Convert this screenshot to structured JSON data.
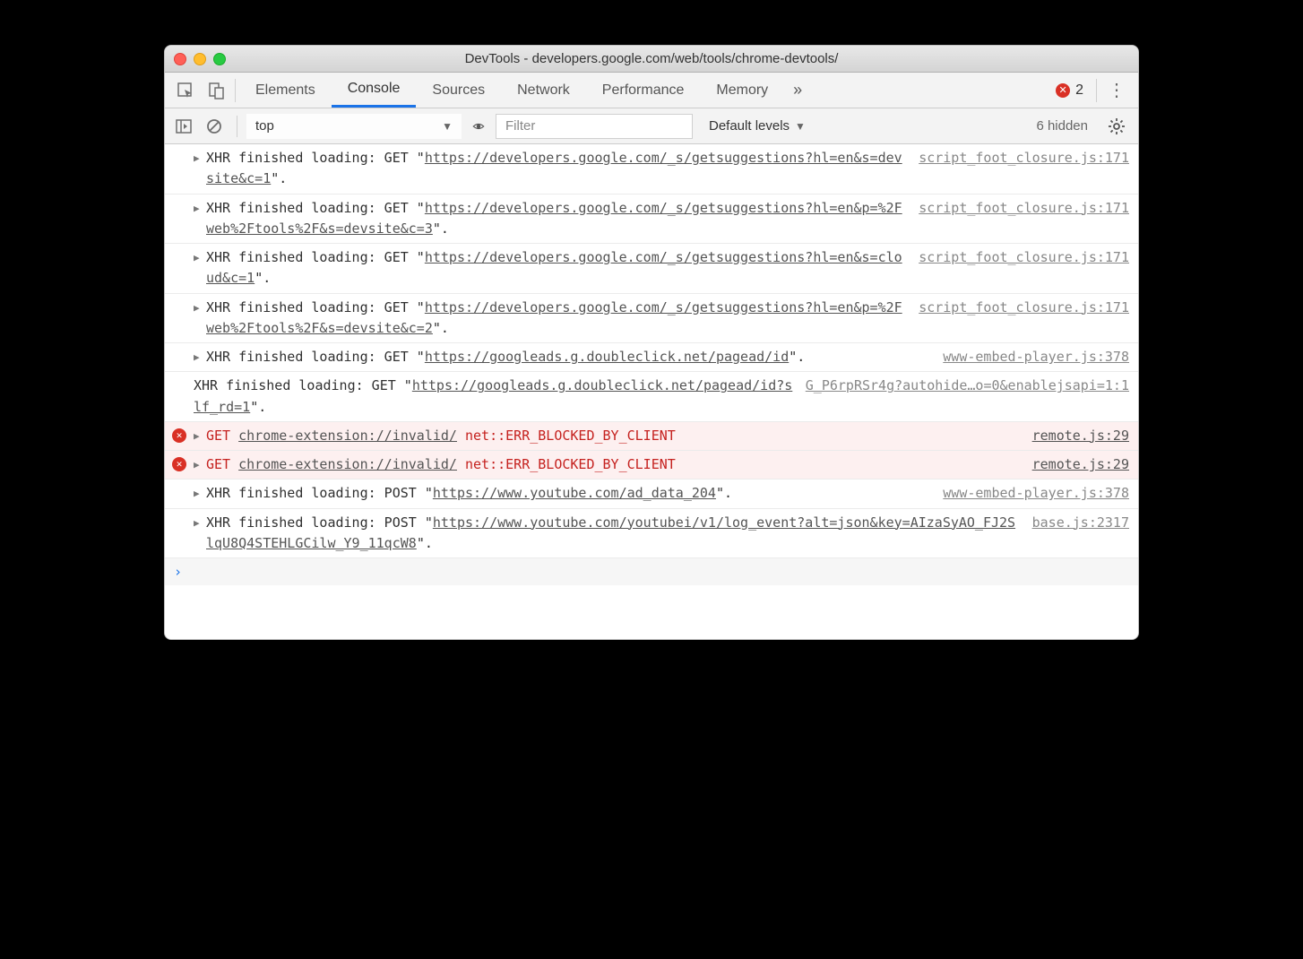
{
  "window": {
    "title": "DevTools - developers.google.com/web/tools/chrome-devtools/"
  },
  "tabs": {
    "items": [
      "Elements",
      "Console",
      "Sources",
      "Network",
      "Performance",
      "Memory"
    ],
    "active": "Console",
    "overflow": "»",
    "error_count": "2"
  },
  "toolbar": {
    "context": "top",
    "filter_placeholder": "Filter",
    "levels": "Default levels",
    "hidden": "6 hidden"
  },
  "log": [
    {
      "type": "xhr",
      "disc": true,
      "prefix": "XHR finished loading: GET \"",
      "url": "https://developers.google.com/_s/getsuggestions?hl=en&s=devsite&c=1",
      "suffix": "\".",
      "src": "script_foot_closure.js:171"
    },
    {
      "type": "xhr",
      "disc": true,
      "prefix": "XHR finished loading: GET \"",
      "url": "https://developers.google.com/_s/getsuggestions?hl=en&p=%2Fweb%2Ftools%2F&s=devsite&c=3",
      "suffix": "\".",
      "src": "script_foot_closure.js:171"
    },
    {
      "type": "xhr",
      "disc": true,
      "prefix": "XHR finished loading: GET \"",
      "url": "https://developers.google.com/_s/getsuggestions?hl=en&s=cloud&c=1",
      "suffix": "\".",
      "src": "script_foot_closure.js:171"
    },
    {
      "type": "xhr",
      "disc": true,
      "prefix": "XHR finished loading: GET \"",
      "url": "https://developers.google.com/_s/getsuggestions?hl=en&p=%2Fweb%2Ftools%2F&s=devsite&c=2",
      "suffix": "\".",
      "src": "script_foot_closure.js:171"
    },
    {
      "type": "xhr",
      "disc": true,
      "prefix": "XHR finished loading: GET \"",
      "url": "https://googleads.g.doubleclick.net/pagead/id",
      "suffix": "\".",
      "src": "www-embed-player.js:378"
    },
    {
      "type": "xhr",
      "disc": false,
      "prefix": "XHR finished loading: GET \"",
      "url": "https://googleads.g.doubleclick.net/pagead/id?slf_rd=1",
      "suffix": "\".",
      "src": "G_P6rpRSr4g?autohide…o=0&enablejsapi=1:1"
    },
    {
      "type": "error",
      "disc": true,
      "method": "GET",
      "url": "chrome-extension://invalid/",
      "status": "net::ERR_BLOCKED_BY_CLIENT",
      "src": "remote.js:29"
    },
    {
      "type": "error",
      "disc": true,
      "method": "GET",
      "url": "chrome-extension://invalid/",
      "status": "net::ERR_BLOCKED_BY_CLIENT",
      "src": "remote.js:29"
    },
    {
      "type": "xhr",
      "disc": true,
      "prefix": "XHR finished loading: POST \"",
      "url": "https://www.youtube.com/ad_data_204",
      "suffix": "\".",
      "src": "www-embed-player.js:378"
    },
    {
      "type": "xhr",
      "disc": true,
      "prefix": "XHR finished loading: POST \"",
      "url": "https://www.youtube.com/youtubei/v1/log_event?alt=json&key=AIzaSyAO_FJ2SlqU8Q4STEHLGCilw_Y9_11qcW8",
      "suffix": "\".",
      "src": "base.js:2317"
    }
  ],
  "prompt": "›"
}
